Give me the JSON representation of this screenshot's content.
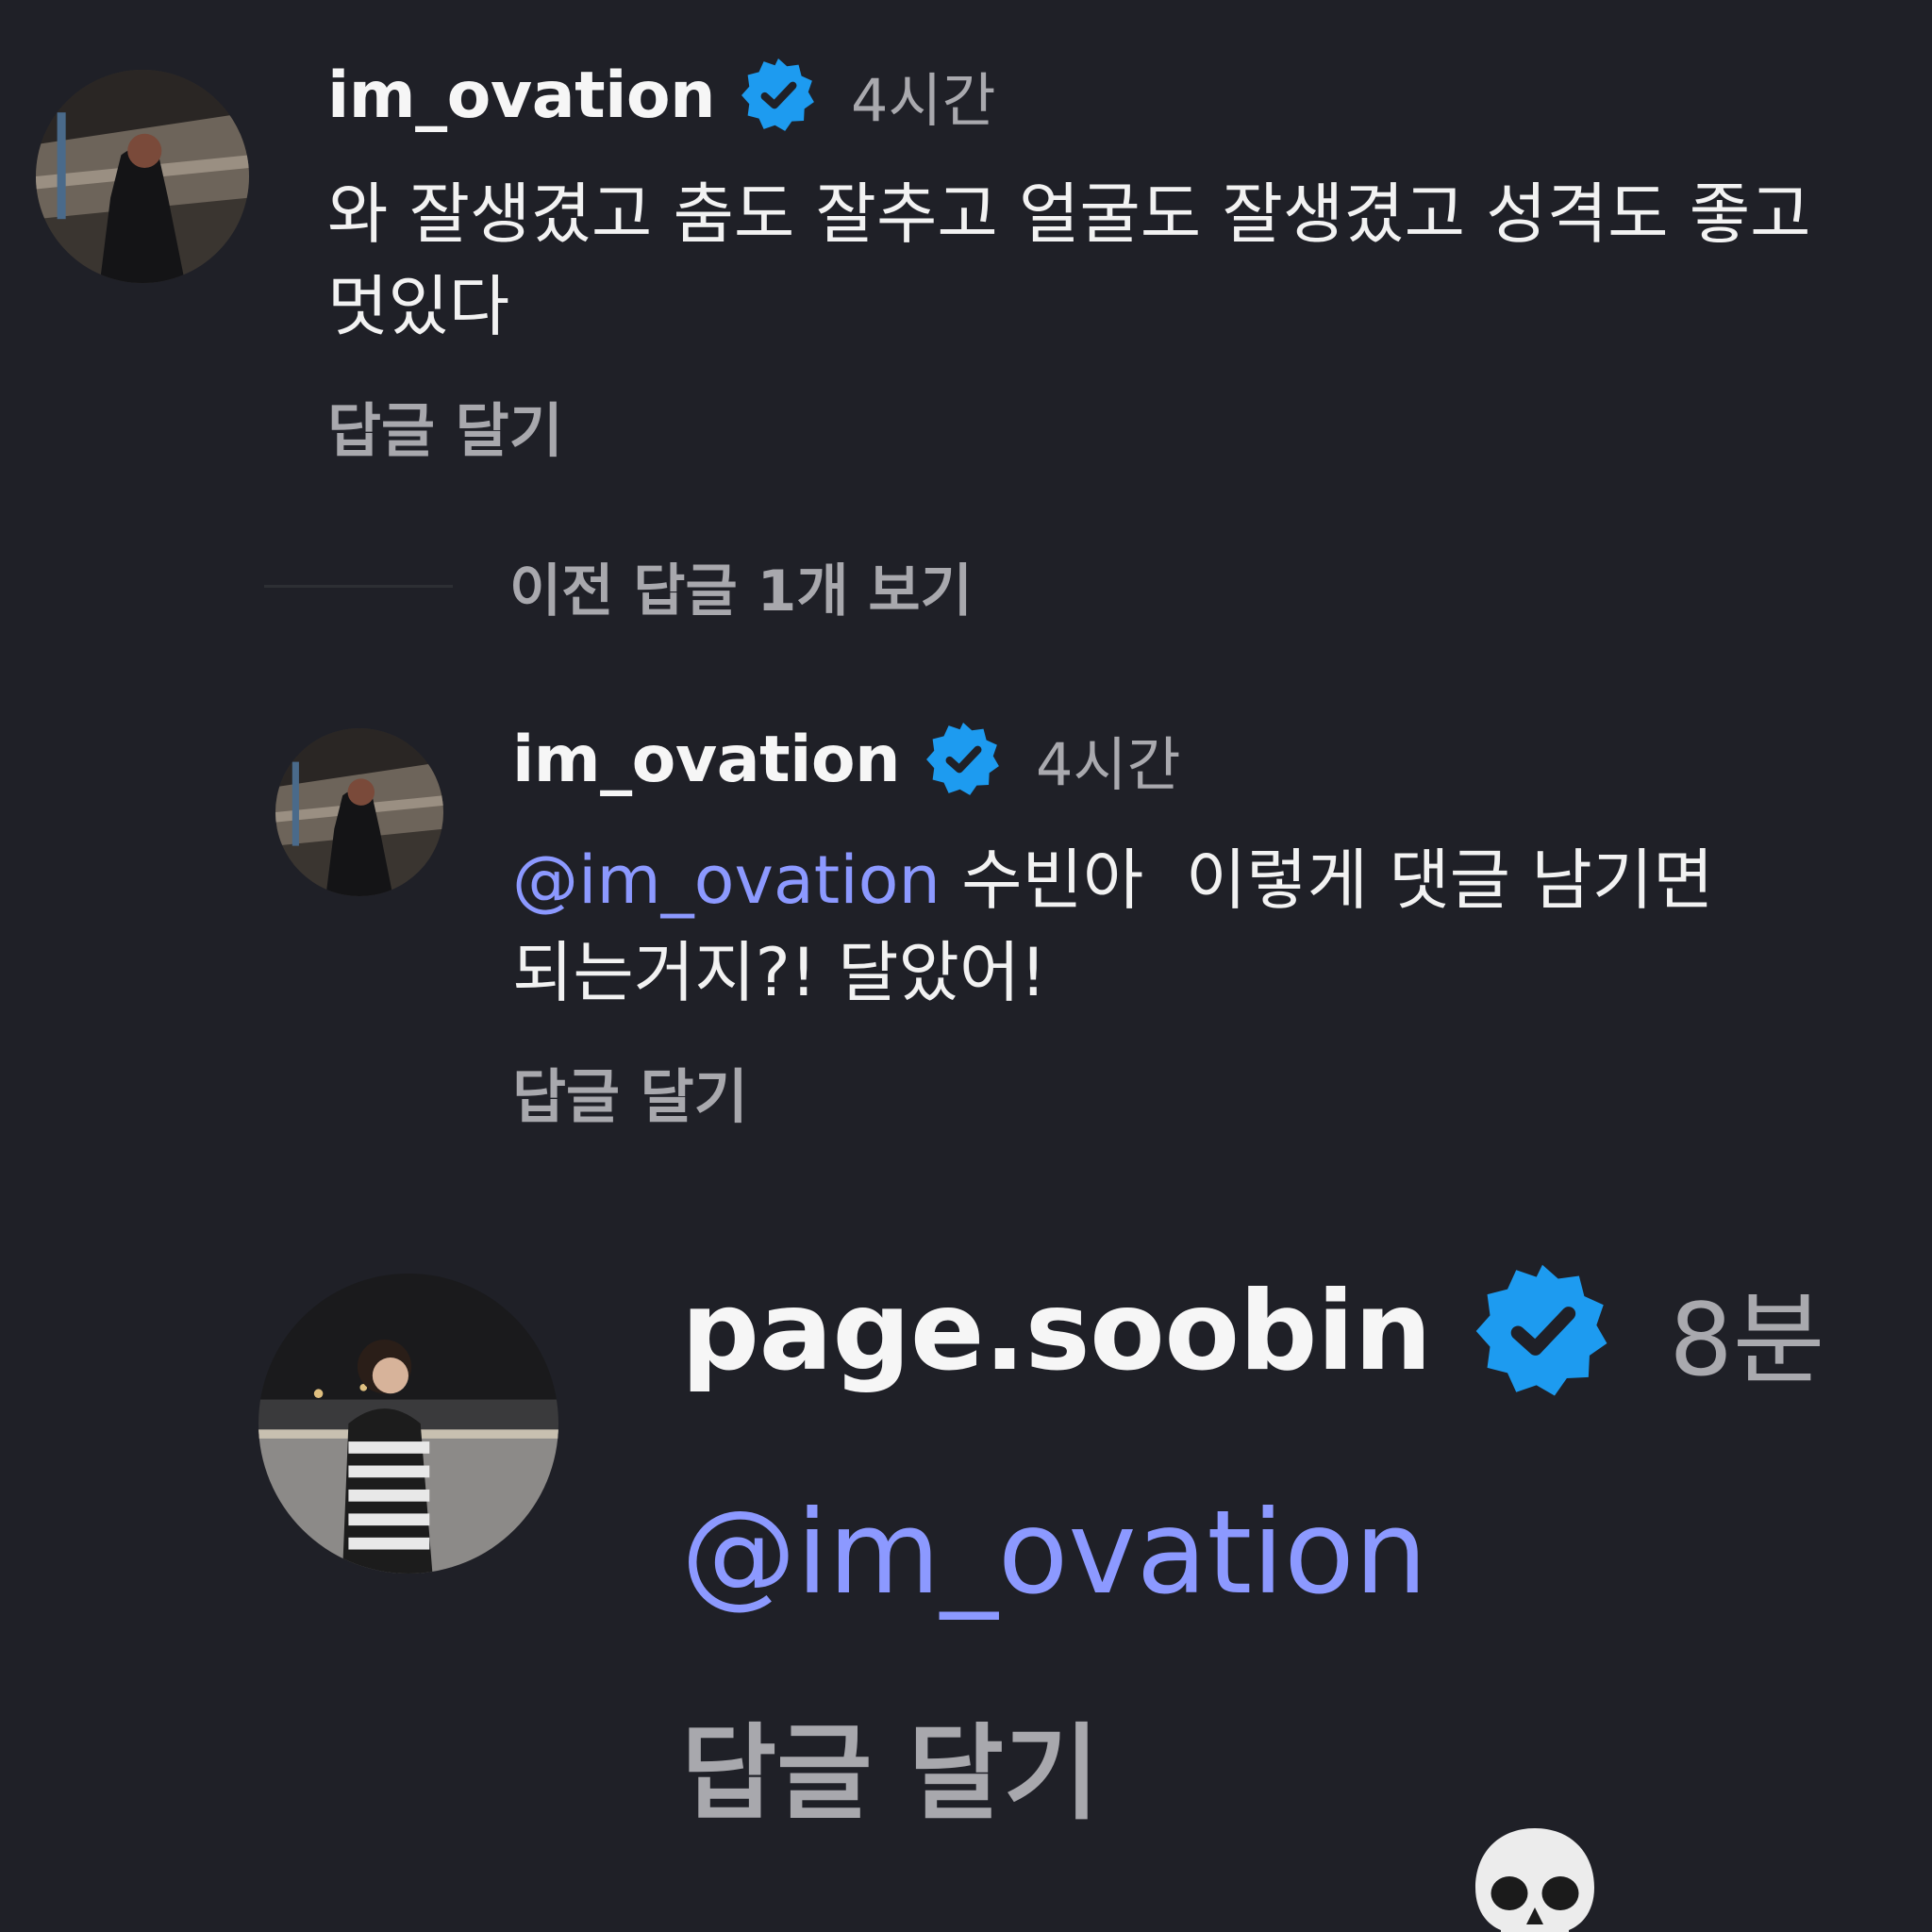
{
  "comments": [
    {
      "username": "im_ovation",
      "time": "4시간",
      "text": "와 잘생겼고 춤도 잘추고 얼굴도 잘생겼고 성격도 좋고 멋있다",
      "reply_label": "답글 달기"
    },
    {
      "username": "im_ovation",
      "time": "4시간",
      "mention": "@im_ovation",
      "text": " 수빈아  이렇게 댓글 남기면 되는거지?! 달았어!",
      "reply_label": "답글 달기"
    },
    {
      "username": "page.soobin",
      "time": "8분",
      "mention": "@im_ovation",
      "emoji": "skull-emoji",
      "reply_label": "답글 달기"
    }
  ],
  "view_previous": "이전 답글 1개 보기",
  "colors": {
    "background": "#1f2027",
    "verified_badge": "#1d9bf0",
    "mention": "#8c99ff",
    "secondary_text": "#a8a8ad"
  },
  "icons": {
    "verified": "verified-badge-icon"
  }
}
